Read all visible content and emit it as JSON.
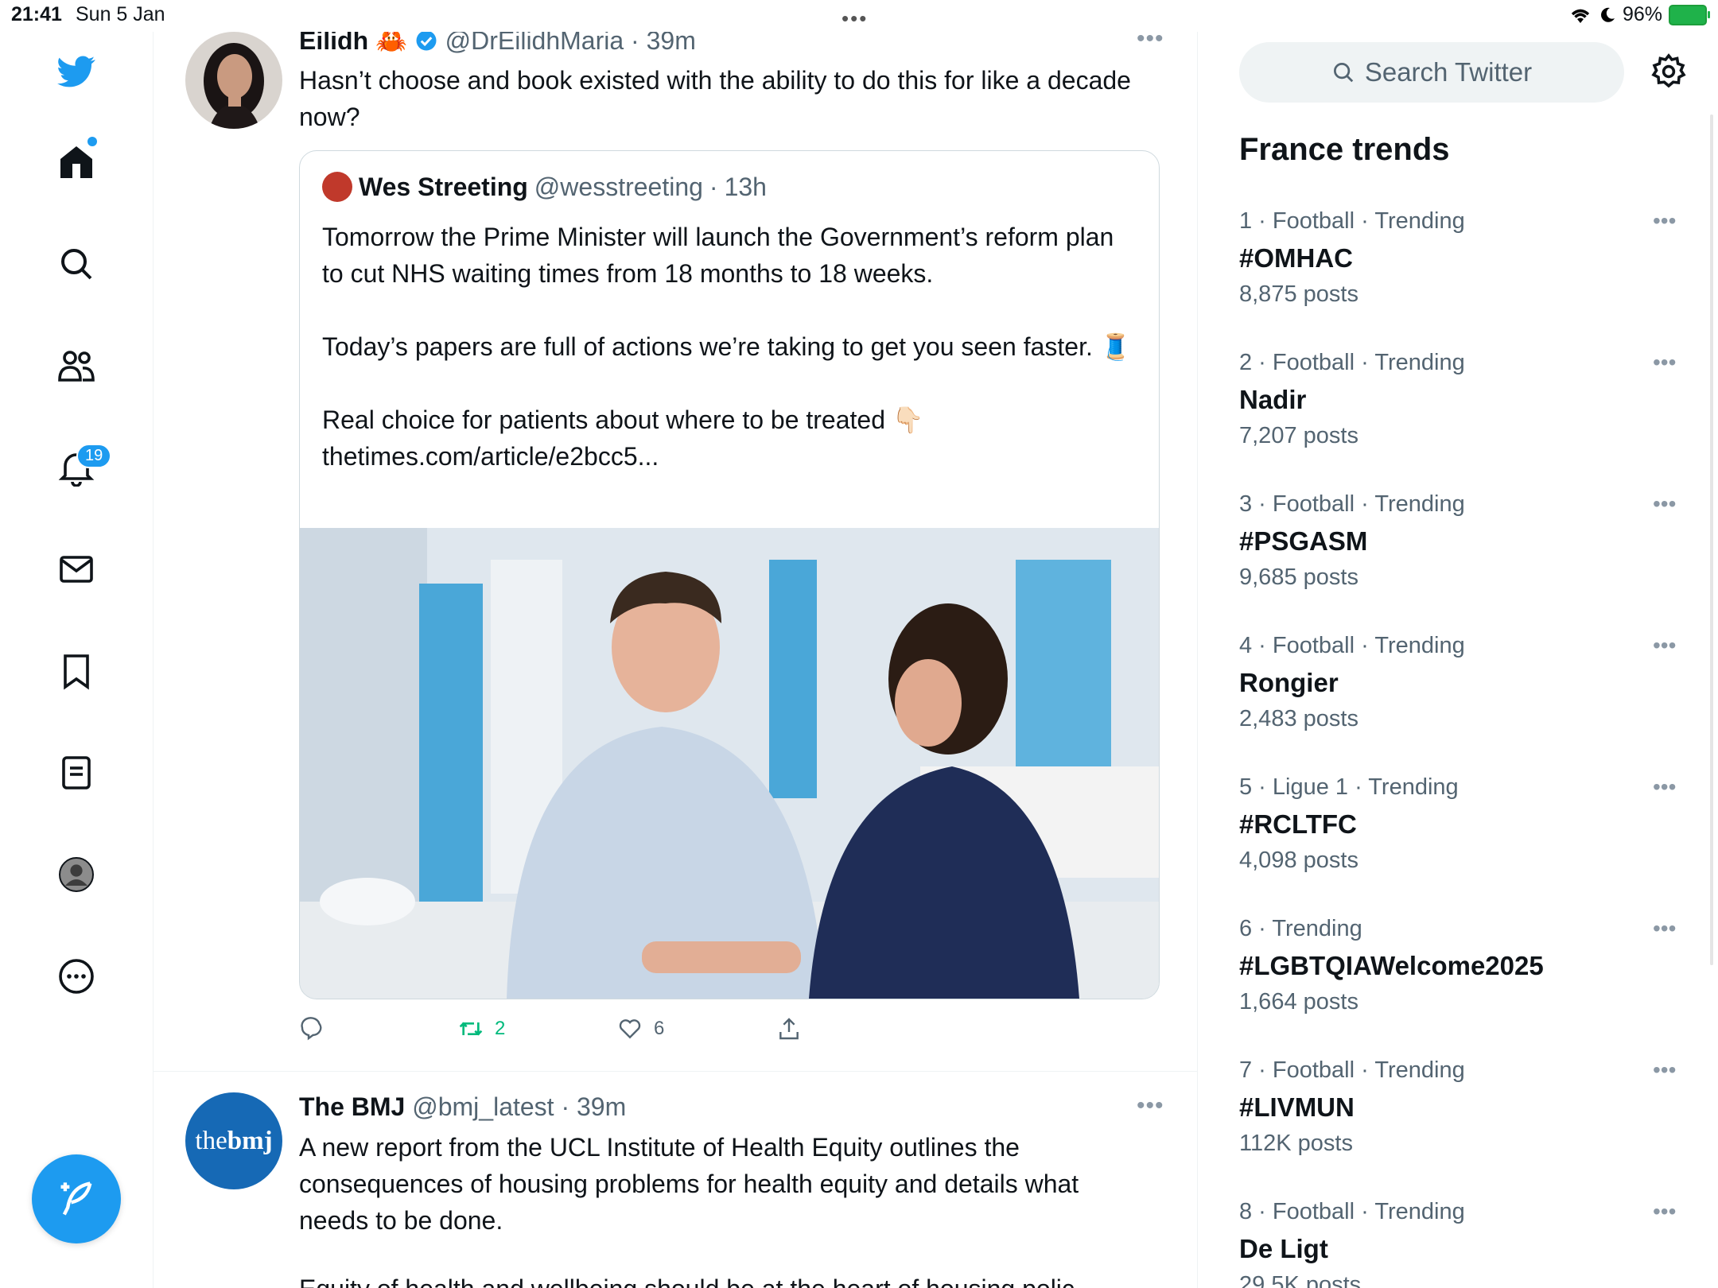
{
  "status_bar": {
    "time": "21:41",
    "date": "Sun 5 Jan",
    "battery": "96%"
  },
  "nav": {
    "notifications_count": "19"
  },
  "feed": {
    "tweet1": {
      "name": "Eilidh 🦀",
      "handle": "@DrEilidhMaria",
      "time": "39m",
      "text": "Hasn’t choose and book existed with the ability to do this for like a decade now?",
      "quote": {
        "name": "Wes Streeting",
        "handle": "@wesstreeting",
        "time": "13h",
        "para1": "Tomorrow the Prime Minister will launch the Government’s reform plan to cut NHS waiting times from 18 months to 18 weeks.",
        "para2": "Today’s papers are full of actions we’re taking to get you seen faster. 🧵",
        "para3": "Real choice for patients about where to be treated 👇🏻\nthetimes.com/article/e2bcc5..."
      },
      "retweets": "2",
      "likes": "6"
    },
    "tweet2": {
      "avatar_text_light": "the",
      "avatar_text_bold": "bmj",
      "name": "The BMJ",
      "handle": "@bmj_latest",
      "time": "39m",
      "text": "A new report from the UCL Institute of Health Equity outlines the consequences of housing problems for health equity and details what needs to be done.",
      "text_cut": "Equity of health and wellbeing should be at the heart of housing polic"
    }
  },
  "sidebar": {
    "search_placeholder": "Search Twitter",
    "trends_title": "France trends",
    "trends": [
      {
        "context": "1 · Football · Trending",
        "name": "#OMHAC",
        "posts": "8,875 posts"
      },
      {
        "context": "2 · Football · Trending",
        "name": "Nadir",
        "posts": "7,207 posts"
      },
      {
        "context": "3 · Football · Trending",
        "name": "#PSGASM",
        "posts": "9,685 posts"
      },
      {
        "context": "4 · Football · Trending",
        "name": "Rongier",
        "posts": "2,483 posts"
      },
      {
        "context": "5 · Ligue 1 · Trending",
        "name": "#RCLTFC",
        "posts": "4,098 posts"
      },
      {
        "context": "6 · Trending",
        "name": "#LGBTQIAWelcome2025",
        "posts": "1,664 posts"
      },
      {
        "context": "7 · Football · Trending",
        "name": "#LIVMUN",
        "posts": "112K posts"
      },
      {
        "context": "8 · Football · Trending",
        "name": "De Ligt",
        "posts": "29.5K posts"
      }
    ]
  },
  "colors": {
    "accent": "#1d9bf0",
    "retweet": "#00ba7c",
    "muted": "#536471"
  },
  "icons": [
    "twitter-logo-icon",
    "home-icon",
    "search-icon",
    "communities-icon",
    "bell-icon",
    "mail-icon",
    "bookmark-icon",
    "lists-icon",
    "profile-icon",
    "more-circle-icon",
    "compose-icon",
    "reply-icon",
    "retweet-icon",
    "like-icon",
    "share-icon",
    "settings-gear-icon",
    "verified-icon"
  ]
}
